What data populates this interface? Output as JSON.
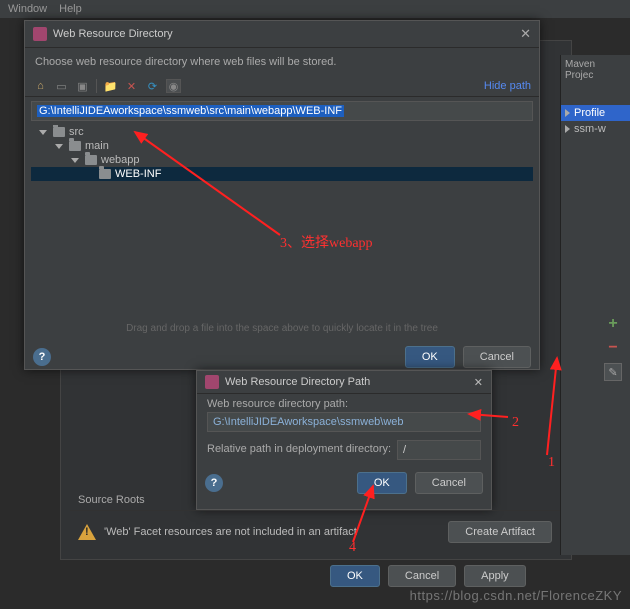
{
  "menubar": {
    "window": "Window",
    "help": "Help"
  },
  "mavenPanel": {
    "header": "Maven Projec",
    "items": [
      {
        "label": "Profile"
      },
      {
        "label": "ssm-w"
      }
    ]
  },
  "dlg1": {
    "title": "Web Resource Directory",
    "prompt": "Choose web resource directory where web files will be stored.",
    "hidePath": "Hide path",
    "path": "G:\\IntelliJIDEAworkspace\\ssmweb\\src\\main\\webapp\\WEB-INF",
    "tree": {
      "src": "src",
      "main": "main",
      "webapp": "webapp",
      "webinf": "WEB-INF"
    },
    "hint": "Drag and drop a file into the space above to quickly locate it in the tree",
    "ok": "OK",
    "cancel": "Cancel"
  },
  "dlg2": {
    "title": "Web Resource Directory Path",
    "label1": "Web resource directory path:",
    "value1": "G:\\IntelliJIDEAworkspace\\ssmweb\\web",
    "label2": "Relative path in deployment directory:",
    "value2": "/",
    "ok": "OK",
    "cancel": "Cancel"
  },
  "lower": {
    "roots": "Source Roots",
    "warn": "'Web' Facet resources are not included in an artifact",
    "create": "Create Artifact",
    "ok": "OK",
    "cancel": "Cancel",
    "apply": "Apply"
  },
  "annot": {
    "l3": "3、选择webapp",
    "l1": "1",
    "l2": "2",
    "l4": "4"
  },
  "watermark": "https://blog.csdn.net/FlorenceZKY"
}
